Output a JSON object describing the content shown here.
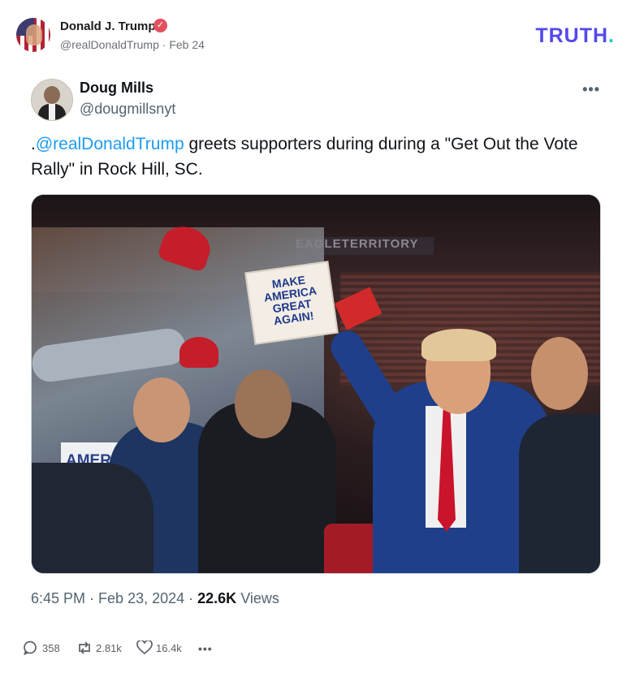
{
  "post": {
    "author_name": "Donald J. Trump",
    "handle": "@realDonaldTrump",
    "date": "Feb 24",
    "brand": "TRUTH",
    "brand_dot": "."
  },
  "embed": {
    "name": "Doug Mills",
    "handle": "@dougmillsnyt",
    "text_prefix": ".",
    "mention": "@realDonaldTrump",
    "text_rest": " greets supporters during during a \"Get Out the Vote Rally\" in Rock Hill, SC.",
    "photo_sign_text": "MAKE AMERICA GREAT AGAIN!",
    "photo_arena_text": "EAGLETERRITORY",
    "photo_sign_partial": "AMER",
    "time": "6:45 PM",
    "date": "Feb 23, 2024",
    "views_count": "22.6K",
    "views_label": "Views"
  },
  "actions": {
    "replies": "358",
    "retruths": "2.81k",
    "likes": "16.4k"
  },
  "colors": {
    "brand": "#5448ee",
    "brand_dot": "#16c8c8",
    "mention": "#1d9bf0",
    "verified": "#e2515f"
  }
}
